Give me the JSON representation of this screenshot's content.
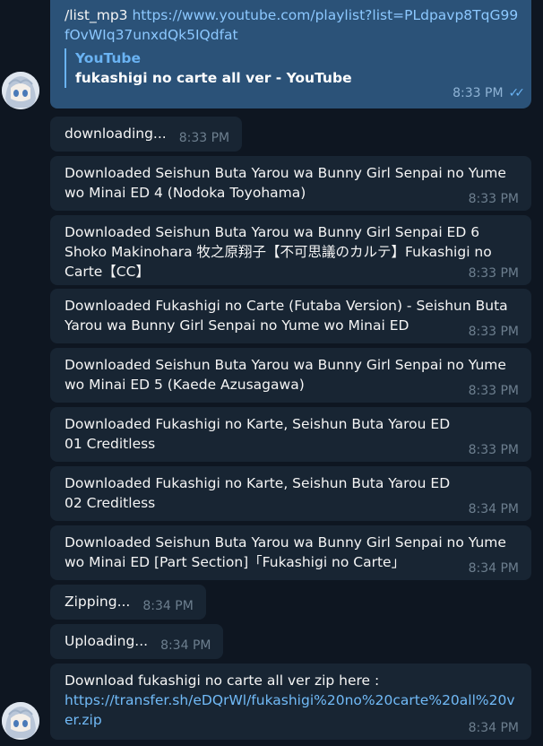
{
  "outgoing": {
    "command": "/list_mp3 https://www.youtube.com/playlist?list=PLdpavp8TqG99fOvWIq37unxdQk5IQdfat",
    "command_prefix": "/list_mp3 ",
    "command_link": "https://www.youtube.com/playlist?list=PLdpavp8TqG99fOvWIq37unxdQk5IQdfat",
    "preview_site": "YouTube",
    "preview_title": "fukashigi no carte all ver - YouTube",
    "time": "8:33 PM",
    "status_icon": "double-check-icon"
  },
  "messages": [
    {
      "text": "downloading...",
      "time": "8:33 PM"
    },
    {
      "text": "Downloaded Seishun Buta Yarou wa Bunny Girl Senpai no Yume wo Minai ED 4 (Nodoka Toyohama)",
      "time": "8:33 PM"
    },
    {
      "text": "Downloaded Seishun Buta Yarou wa Bunny Girl Senpai ED 6 Shoko Makinohara 牧之原翔子【不可思議のカルテ】Fukashigi no Carte【CC】",
      "time": "8:33 PM"
    },
    {
      "text": "Downloaded Fukashigi no Carte (Futaba Version) - Seishun Buta Yarou wa Bunny Girl Senpai no Yume wo Minai ED",
      "time": "8:33 PM"
    },
    {
      "text": "Downloaded Seishun Buta Yarou wa Bunny Girl Senpai no Yume wo Minai ED 5 (Kaede Azusagawa)",
      "time": "8:33 PM"
    },
    {
      "text": "Downloaded Fukashigi no Karte, Seishun Buta Yarou ED 01 Creditless",
      "time": "8:33 PM"
    },
    {
      "text": "Downloaded Fukashigi no Karte, Seishun Buta Yarou ED 02 Creditless",
      "time": "8:34 PM"
    },
    {
      "text": "Downloaded Seishun Buta Yarou wa Bunny Girl Senpai no Yume wo Minai ED [Part Section]「Fukashigi no Carte」",
      "time": "8:34 PM"
    },
    {
      "text": "Zipping...",
      "time": "8:34 PM"
    },
    {
      "text": "Uploading...",
      "time": "8:34 PM"
    },
    {
      "text": "Download fukashigi no carte all ver zip here :",
      "link": "https://transfer.sh/eDQrWl/fukashigi%20no%20carte%20all%20ver.zip",
      "time": "8:34 PM"
    }
  ]
}
